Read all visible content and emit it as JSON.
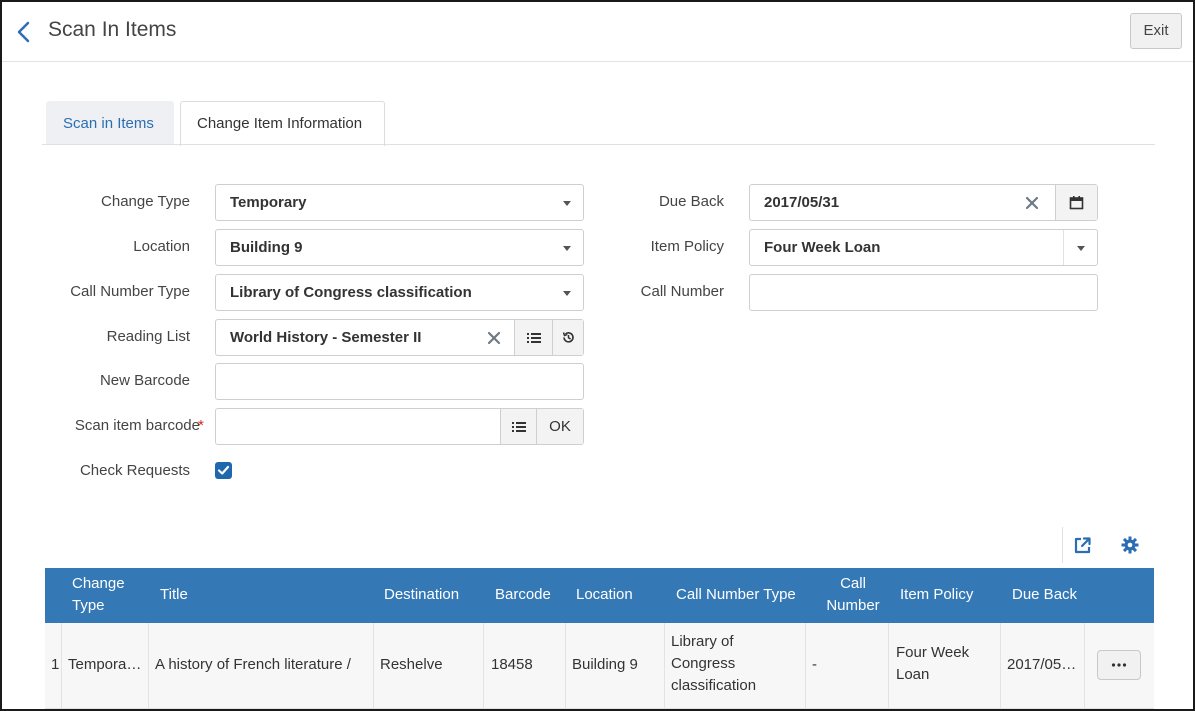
{
  "header": {
    "title": "Scan In Items",
    "exit_label": "Exit"
  },
  "tabs": [
    {
      "label": "Scan in Items"
    },
    {
      "label": "Change Item Information"
    }
  ],
  "form": {
    "change_type": {
      "label": "Change Type",
      "value": "Temporary"
    },
    "location": {
      "label": "Location",
      "value": "Building 9"
    },
    "call_number_type": {
      "label": "Call Number Type",
      "value": "Library of Congress classification"
    },
    "reading_list": {
      "label": "Reading List",
      "value": "World History - Semester II"
    },
    "new_barcode": {
      "label": "New Barcode",
      "value": ""
    },
    "scan_barcode": {
      "label": "Scan item barcode",
      "required": "*",
      "value": "",
      "ok_label": "OK"
    },
    "check_requests": {
      "label": "Check Requests",
      "checked": true
    },
    "due_back": {
      "label": "Due Back",
      "value": "2017/05/31"
    },
    "item_policy": {
      "label": "Item Policy",
      "value": "Four Week Loan"
    },
    "call_number": {
      "label": "Call Number",
      "value": ""
    }
  },
  "table": {
    "columns": [
      "Change Type",
      "Title",
      "Destination",
      "Barcode",
      "Location",
      "Call Number Type",
      "Call Number",
      "Item Policy",
      "Due Back"
    ],
    "col_change_type": [
      "Change",
      "Type"
    ],
    "col_call_number": [
      "Call",
      "Number"
    ],
    "rows": [
      {
        "index": "1",
        "change_type": "Tempora…",
        "title": "A history of French literature /",
        "destination": "Reshelve",
        "barcode": "18458",
        "location": "Building 9",
        "call_number_type": [
          "Library of",
          "Congress",
          "classification"
        ],
        "call_number": "-",
        "item_policy": [
          "Four Week",
          "Loan"
        ],
        "due_back": "2017/05…"
      }
    ]
  },
  "icons": [
    "back-chevron-icon",
    "caret-down-icon",
    "clear-x-icon",
    "calendar-icon",
    "list-icon",
    "history-icon",
    "checkbox-check-icon",
    "export-icon",
    "gear-icon",
    "ellipsis-icon"
  ],
  "colors": {
    "accent": "#3478b6",
    "link": "#2c6eb3",
    "checkbox": "#2068ad"
  }
}
